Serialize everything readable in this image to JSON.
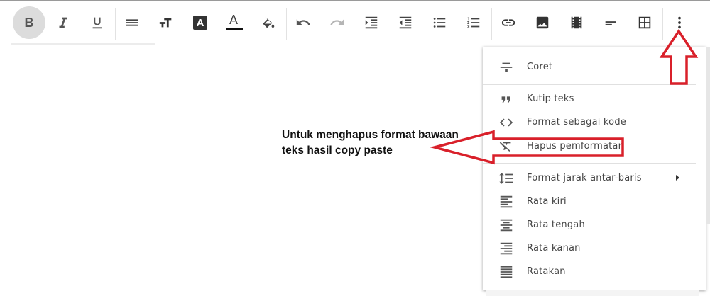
{
  "toolbar": {
    "buttons": [
      {
        "name": "bold-button",
        "icon": "bold-icon",
        "label": "B"
      },
      {
        "name": "italic-button",
        "icon": "italic-icon"
      },
      {
        "name": "underline-button",
        "icon": "underline-icon"
      },
      {
        "name": "align-button",
        "icon": "align-icon"
      },
      {
        "name": "font-size-button",
        "icon": "font-size-icon"
      },
      {
        "name": "text-background-button",
        "icon": "text-background-icon",
        "label": "A"
      },
      {
        "name": "text-color-button",
        "icon": "text-color-icon",
        "label": "A"
      },
      {
        "name": "highlight-color-button",
        "icon": "paint-bucket-icon"
      },
      {
        "name": "undo-button",
        "icon": "undo-icon"
      },
      {
        "name": "redo-button",
        "icon": "redo-icon"
      },
      {
        "name": "indent-button",
        "icon": "indent-icon"
      },
      {
        "name": "outdent-button",
        "icon": "outdent-icon"
      },
      {
        "name": "bulleted-list-button",
        "icon": "bulleted-list-icon"
      },
      {
        "name": "numbered-list-button",
        "icon": "numbered-list-icon"
      },
      {
        "name": "link-button",
        "icon": "link-icon"
      },
      {
        "name": "image-button",
        "icon": "image-icon"
      },
      {
        "name": "video-button",
        "icon": "film-icon"
      },
      {
        "name": "read-more-button",
        "icon": "break-icon"
      },
      {
        "name": "table-button",
        "icon": "table-icon"
      },
      {
        "name": "more-options-button",
        "icon": "more-vert-icon"
      }
    ],
    "bold_label": "B",
    "text_bg_label": "A",
    "text_color_label": "A"
  },
  "menu": {
    "items": [
      {
        "label": "Coret",
        "icon": "strikethrough-icon"
      },
      {
        "label": "Kutip teks",
        "icon": "quote-icon"
      },
      {
        "label": "Format sebagai kode",
        "icon": "code-icon"
      },
      {
        "label": "Hapus pemformatan",
        "icon": "clear-format-icon"
      },
      {
        "label": "Format jarak antar-baris",
        "icon": "line-spacing-icon",
        "submenu": true
      },
      {
        "label": "Rata kiri",
        "icon": "align-left-icon"
      },
      {
        "label": "Rata tengah",
        "icon": "align-center-icon"
      },
      {
        "label": "Rata kanan",
        "icon": "align-right-icon"
      },
      {
        "label": "Ratakan",
        "icon": "align-justify-icon"
      }
    ]
  },
  "annotation": {
    "line1": "Untuk menghapus format bawaan",
    "line2": "teks hasil copy paste"
  },
  "colors": {
    "annotation_red": "#d9202a",
    "active_button_bg": "#dcdcdc",
    "icon_gray": "#444444",
    "disabled_icon": "#b5b5b5"
  }
}
